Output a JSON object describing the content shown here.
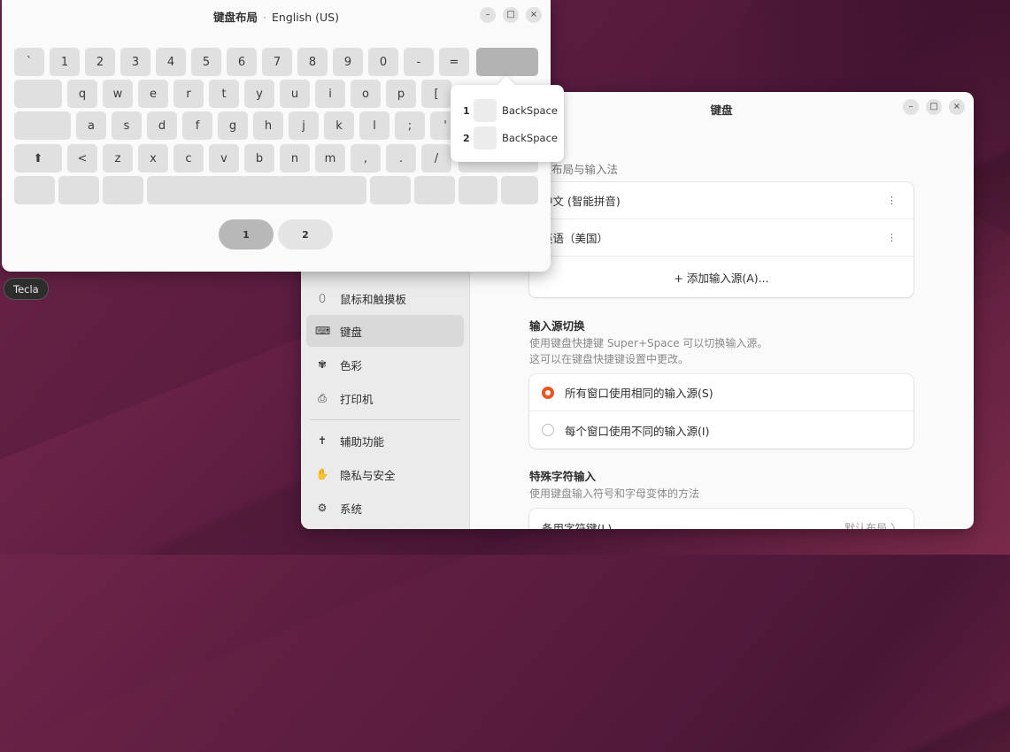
{
  "colors": {
    "accent": "#e95420",
    "key_bg": "#e0e0e0",
    "key_selected": "#b3b3b3"
  },
  "settings_window": {
    "title": "键盘",
    "controls": {
      "minimize": "–",
      "maximize": "□",
      "close": "×"
    },
    "sidebar": [
      {
        "icon": "mouse-icon",
        "glyph": "⬯",
        "label": "鼠标和触摸板",
        "active": false
      },
      {
        "icon": "keyboard-icon",
        "glyph": "⌨",
        "label": "键盘",
        "active": true
      },
      {
        "icon": "color-icon",
        "glyph": "✾",
        "label": "色彩",
        "active": false
      },
      {
        "icon": "printer-icon",
        "glyph": "⎙",
        "label": "打印机",
        "active": false
      },
      {
        "icon": "accessibility-icon",
        "glyph": "✝",
        "label": "辅助功能",
        "active": false
      },
      {
        "icon": "privacy-icon",
        "glyph": "✋",
        "label": "隐私与安全",
        "active": false
      },
      {
        "icon": "system-icon",
        "glyph": "⚙",
        "label": "系统",
        "active": false
      }
    ],
    "input_sources": {
      "label": "键盘布局与输入法",
      "items": [
        "中文 (智能拼音)",
        "英语（美国）"
      ],
      "kebab": "⋮",
      "add_label": "+ 添加输入源(A)..."
    },
    "switching": {
      "heading": "输入源切换",
      "desc_line1": "使用键盘快捷键 Super+Space 可以切换输入源。",
      "desc_line2": "这可以在键盘快捷键设置中更改。",
      "options": [
        {
          "label": "所有窗口使用相同的输入源(S)",
          "selected": true
        },
        {
          "label": "每个窗口使用不同的输入源(I)",
          "selected": false
        }
      ]
    },
    "special_chars": {
      "heading": "特殊字符输入",
      "desc": "使用键盘输入符号和字母变体的方法",
      "row_label": "备用字符键(L)",
      "row_value": "默认布局 〉"
    }
  },
  "keyboard_window": {
    "title_bold": "键盘布局",
    "title_sep": "·",
    "title_layout": "English (US)",
    "controls": {
      "minimize": "–",
      "maximize": "□",
      "close": "×"
    },
    "row1": [
      "`",
      "1",
      "2",
      "3",
      "4",
      "5",
      "6",
      "7",
      "8",
      "9",
      "0",
      "-",
      "=",
      ""
    ],
    "row2": [
      "",
      "q",
      "w",
      "e",
      "r",
      "t",
      "y",
      "u",
      "i",
      "o",
      "p",
      "["
    ],
    "row3": [
      "",
      "a",
      "s",
      "d",
      "f",
      "g",
      "h",
      "j",
      "k",
      "l",
      ";",
      "'"
    ],
    "row4": [
      "⬆",
      "<",
      "z",
      "x",
      "c",
      "v",
      "b",
      "n",
      "m",
      ",",
      ".",
      "/",
      ""
    ],
    "row5": [
      "",
      "",
      "",
      "",
      "",
      "",
      "",
      ""
    ],
    "levels": [
      "1",
      "2"
    ],
    "popover": [
      {
        "level": "1",
        "key": "BackSpace"
      },
      {
        "level": "2",
        "key": "BackSpace"
      }
    ]
  },
  "tooltip": "Tecla"
}
